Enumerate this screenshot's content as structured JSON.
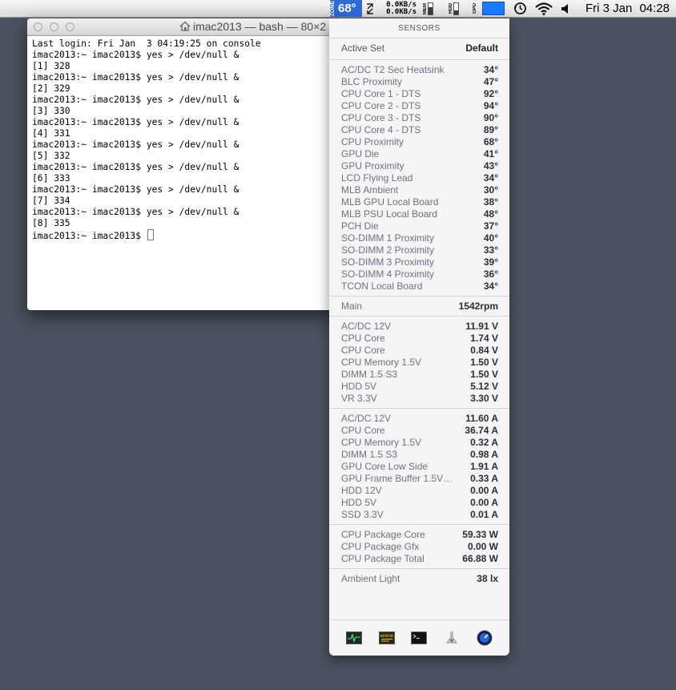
{
  "menubar": {
    "temp": "68°",
    "temp_zone_label": "ZONE",
    "net_up": "0.0KB/s",
    "net_down": "0.0KB/s",
    "mem_label": "MEM",
    "hdd_label": "HDD",
    "gpu_label": "GPU",
    "date": "Fri 3 Jan",
    "time": "04:28",
    "icons": [
      "sensor-icon",
      "network-icon",
      "memory-gauge",
      "disk-gauge",
      "gpu-gauge",
      "time-machine-icon",
      "wifi-icon",
      "volume-icon"
    ]
  },
  "terminal": {
    "title": "imac2013 — bash — 80×2",
    "lines": [
      "Last login: Fri Jan  3 04:19:25 on console",
      "imac2013:~ imac2013$ yes > /dev/null &",
      "[1] 328",
      "imac2013:~ imac2013$ yes > /dev/null &",
      "[2] 329",
      "imac2013:~ imac2013$ yes > /dev/null &",
      "[3] 330",
      "imac2013:~ imac2013$ yes > /dev/null &",
      "[4] 331",
      "imac2013:~ imac2013$ yes > /dev/null &",
      "[5] 332",
      "imac2013:~ imac2013$ yes > /dev/null &",
      "[6] 333",
      "imac2013:~ imac2013$ yes > /dev/null &",
      "[7] 334",
      "imac2013:~ imac2013$ yes > /dev/null &",
      "[8] 335"
    ],
    "prompt": "imac2013:~ imac2013$ "
  },
  "sensors": {
    "header": "SENSORS",
    "active_set": {
      "name": "Active Set",
      "value": "Default"
    },
    "temperatures": [
      {
        "name": "AC/DC T2 Sec Heatsink",
        "value": "34°"
      },
      {
        "name": "BLC Proximity",
        "value": "47°"
      },
      {
        "name": "CPU Core 1 - DTS",
        "value": "92°"
      },
      {
        "name": "CPU Core 2 - DTS",
        "value": "94°"
      },
      {
        "name": "CPU Core 3 - DTS",
        "value": "90°"
      },
      {
        "name": "CPU Core 4 - DTS",
        "value": "89°"
      },
      {
        "name": "CPU Proximity",
        "value": "68°"
      },
      {
        "name": "GPU Die",
        "value": "41°"
      },
      {
        "name": "GPU Proximity",
        "value": "43°"
      },
      {
        "name": "LCD Flying Lead",
        "value": "34°"
      },
      {
        "name": "MLB Ambient",
        "value": "30°"
      },
      {
        "name": "MLB GPU Local Board",
        "value": "38°"
      },
      {
        "name": "MLB PSU Local Board",
        "value": "48°"
      },
      {
        "name": "PCH Die",
        "value": "37°"
      },
      {
        "name": "SO-DIMM 1 Proximity",
        "value": "40°"
      },
      {
        "name": "SO-DIMM 2 Proximity",
        "value": "33°"
      },
      {
        "name": "SO-DIMM 3 Proximity",
        "value": "39°"
      },
      {
        "name": "SO-DIMM 4 Proximity",
        "value": "36°"
      },
      {
        "name": "TCON Local Board",
        "value": "34°"
      }
    ],
    "fans": [
      {
        "name": "Main",
        "value": "1542rpm"
      }
    ],
    "voltages": [
      {
        "name": "AC/DC 12V",
        "value": "11.91 V"
      },
      {
        "name": "CPU Core",
        "value": "1.74 V"
      },
      {
        "name": "CPU Core",
        "value": "0.84 V"
      },
      {
        "name": "CPU Memory 1.5V",
        "value": "1.50 V"
      },
      {
        "name": "DIMM 1.5 S3",
        "value": "1.50 V"
      },
      {
        "name": "HDD 5V",
        "value": "5.12 V"
      },
      {
        "name": "VR 3.3V",
        "value": "3.30 V"
      }
    ],
    "currents": [
      {
        "name": "AC/DC 12V",
        "value": "11.60 A"
      },
      {
        "name": "CPU Core",
        "value": "36.74 A"
      },
      {
        "name": "CPU Memory 1.5V",
        "value": "0.32 A"
      },
      {
        "name": "DIMM 1.5 S3",
        "value": "0.98 A"
      },
      {
        "name": "GPU Core Low Side",
        "value": "1.91 A"
      },
      {
        "name": "GPU Frame Buffer 1.5V…",
        "value": "0.33 A"
      },
      {
        "name": "HDD 12V",
        "value": "0.00 A"
      },
      {
        "name": "HDD 5V",
        "value": "0.00 A"
      },
      {
        "name": "SSD 3.3V",
        "value": "0.01 A"
      }
    ],
    "power": [
      {
        "name": "CPU Package Core",
        "value": "59.33 W"
      },
      {
        "name": "CPU Package Gfx",
        "value": "0.00 W"
      },
      {
        "name": "CPU Package Total",
        "value": "66.88 W"
      }
    ],
    "light": [
      {
        "name": "Ambient Light",
        "value": "38 lx"
      }
    ],
    "footer_icons": [
      "activity-monitor-icon",
      "console-icon",
      "terminal-icon",
      "system-information-icon",
      "network-utility-icon"
    ],
    "footer_console_text": "WARNING"
  }
}
